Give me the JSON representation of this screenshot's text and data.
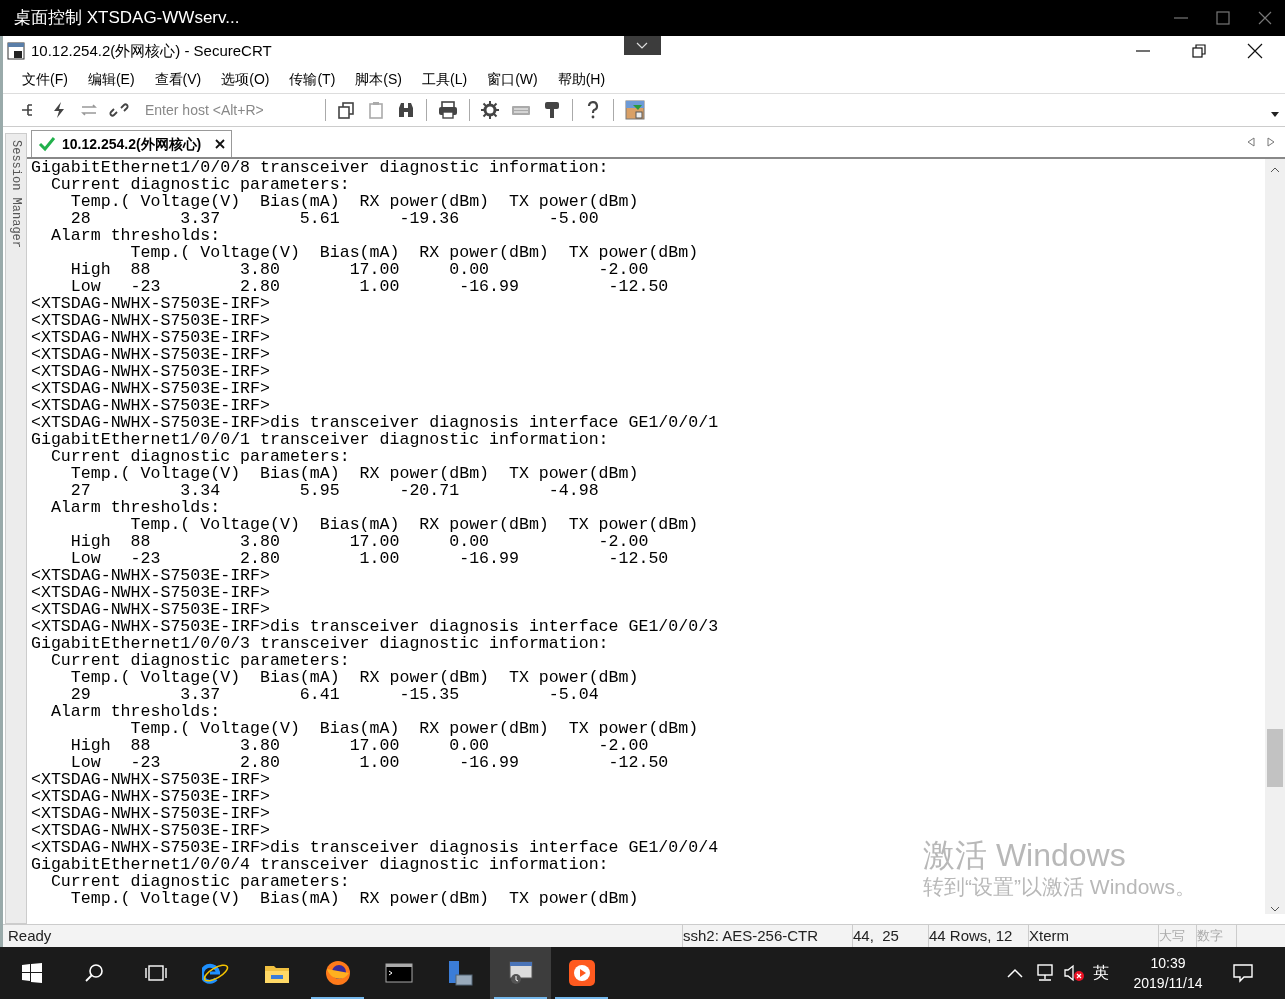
{
  "remote_window": {
    "title": "桌面控制 XTSDAG-WWserv..."
  },
  "window": {
    "title": "10.12.254.2(外网核心) - SecureCRT"
  },
  "menu": [
    "文件(F)",
    "编辑(E)",
    "查看(V)",
    "选项(O)",
    "传输(T)",
    "脚本(S)",
    "工具(L)",
    "窗口(W)",
    "帮助(H)"
  ],
  "toolbar": {
    "host_placeholder": "Enter host <Alt+R>"
  },
  "session_manager": {
    "label": "Session Manager"
  },
  "tabs": [
    {
      "label": "10.12.254.2(外网核心)",
      "selected": true,
      "connected": true
    }
  ],
  "terminal": {
    "lines": [
      "GigabitEthernet1/0/0/8 transceiver diagnostic information:",
      "  Current diagnostic parameters:",
      "    Temp.( Voltage(V)  Bias(mA)  RX power(dBm)  TX power(dBm)",
      "    28         3.37        5.61      -19.36         -5.00",
      "  Alarm thresholds:",
      "          Temp.( Voltage(V)  Bias(mA)  RX power(dBm)  TX power(dBm)",
      "    High  88         3.80       17.00     0.00           -2.00",
      "    Low   -23        2.80        1.00      -16.99         -12.50",
      "<XTSDAG-NWHX-S7503E-IRF>",
      "<XTSDAG-NWHX-S7503E-IRF>",
      "<XTSDAG-NWHX-S7503E-IRF>",
      "<XTSDAG-NWHX-S7503E-IRF>",
      "<XTSDAG-NWHX-S7503E-IRF>",
      "<XTSDAG-NWHX-S7503E-IRF>",
      "<XTSDAG-NWHX-S7503E-IRF>",
      "<XTSDAG-NWHX-S7503E-IRF>dis transceiver diagnosis interface GE1/0/0/1",
      "GigabitEthernet1/0/0/1 transceiver diagnostic information:",
      "  Current diagnostic parameters:",
      "    Temp.( Voltage(V)  Bias(mA)  RX power(dBm)  TX power(dBm)",
      "    27         3.34        5.95      -20.71         -4.98",
      "  Alarm thresholds:",
      "          Temp.( Voltage(V)  Bias(mA)  RX power(dBm)  TX power(dBm)",
      "    High  88         3.80       17.00     0.00           -2.00",
      "    Low   -23        2.80        1.00      -16.99         -12.50",
      "<XTSDAG-NWHX-S7503E-IRF>",
      "<XTSDAG-NWHX-S7503E-IRF>",
      "<XTSDAG-NWHX-S7503E-IRF>",
      "<XTSDAG-NWHX-S7503E-IRF>dis transceiver diagnosis interface GE1/0/0/3",
      "GigabitEthernet1/0/0/3 transceiver diagnostic information:",
      "  Current diagnostic parameters:",
      "    Temp.( Voltage(V)  Bias(mA)  RX power(dBm)  TX power(dBm)",
      "    29         3.37        6.41      -15.35         -5.04",
      "  Alarm thresholds:",
      "          Temp.( Voltage(V)  Bias(mA)  RX power(dBm)  TX power(dBm)",
      "    High  88         3.80       17.00     0.00           -2.00",
      "    Low   -23        2.80        1.00      -16.99         -12.50",
      "<XTSDAG-NWHX-S7503E-IRF>",
      "<XTSDAG-NWHX-S7503E-IRF>",
      "<XTSDAG-NWHX-S7503E-IRF>",
      "<XTSDAG-NWHX-S7503E-IRF>",
      "<XTSDAG-NWHX-S7503E-IRF>dis transceiver diagnosis interface GE1/0/0/4",
      "GigabitEthernet1/0/0/4 transceiver diagnostic information:",
      "  Current diagnostic parameters:",
      "    Temp.( Voltage(V)  Bias(mA)  RX power(dBm)  TX power(dBm)"
    ]
  },
  "activation_notice": {
    "title": "激活 Windows",
    "subtitle": "转到“设置”以激活 Windows。"
  },
  "status_bar": [
    {
      "text": "Ready",
      "disabled": false
    },
    {
      "text": "ssh2: AES-256-CTR",
      "disabled": false
    },
    {
      "text": "44,  25",
      "disabled": false
    },
    {
      "text": "44 Rows, 12",
      "disabled": false
    },
    {
      "text": "Xterm",
      "disabled": false
    },
    {
      "text": "大写",
      "disabled": true
    },
    {
      "text": "数字",
      "disabled": true
    }
  ],
  "taskbar": {
    "apps": [
      {
        "kind": "ie",
        "running": false,
        "selected": false
      },
      {
        "kind": "folder",
        "running": false,
        "selected": false
      },
      {
        "kind": "firefox",
        "running": true,
        "selected": false
      },
      {
        "kind": "console",
        "running": false,
        "selected": false
      },
      {
        "kind": "server",
        "running": false,
        "selected": false
      },
      {
        "kind": "remote",
        "running": true,
        "selected": true
      },
      {
        "kind": "orange",
        "running": true,
        "selected": false
      }
    ],
    "tray": {
      "ime": "英",
      "time": "10:39",
      "date": "2019/11/14"
    }
  }
}
